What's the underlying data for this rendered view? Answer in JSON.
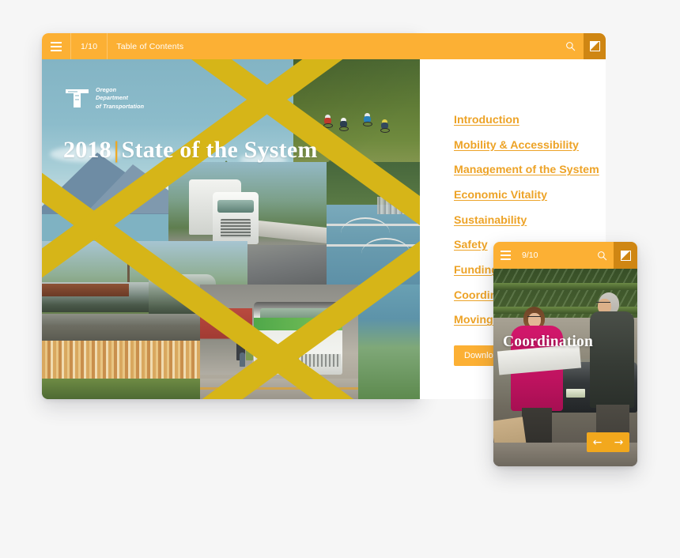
{
  "desktop": {
    "topbar": {
      "menu_icon": "hamburger-menu-icon",
      "page_indicator": "1/10",
      "title": "Table of Contents",
      "search_icon": "search-icon",
      "flip_icon": "flip-page-icon"
    },
    "hero": {
      "logo_text": "Oregon\nDepartment\nof Transportation",
      "title_year": "2018",
      "title_separator": "|",
      "title_main": "State of the System"
    },
    "toc": {
      "links": [
        "Introduction",
        "Mobility & Accessibility",
        "Management of the System",
        "Economic Vitality",
        "Sustainability",
        "Safety",
        "Funding",
        "Coordination",
        "Moving Forward"
      ],
      "download_label": "Download PDF"
    }
  },
  "mobile": {
    "topbar": {
      "menu_icon": "hamburger-menu-icon",
      "page_indicator": "9/10",
      "search_icon": "search-icon",
      "flip_icon": "flip-page-icon"
    },
    "slide_title": "Coordination",
    "nav": {
      "prev_label": "←",
      "next_label": "→"
    }
  },
  "colors": {
    "accent_orange": "#fcb034",
    "accent_orange_dark": "#cf8613",
    "link_orange": "#eda327",
    "band_gold": "#d6b518",
    "page_bg": "#f6f6f6"
  }
}
